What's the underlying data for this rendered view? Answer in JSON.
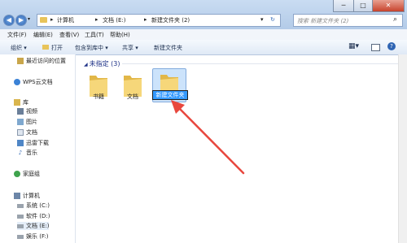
{
  "address": {
    "crumbs": [
      "计算机",
      "文档 (E:)",
      "新建文件夹 (2)"
    ],
    "search_placeholder": "搜索 新建文件夹 (2)"
  },
  "window_buttons": {
    "min": "─",
    "max": "□",
    "close": "✕"
  },
  "menu": [
    "文件(F)",
    "编辑(E)",
    "查看(V)",
    "工具(T)",
    "帮助(H)"
  ],
  "toolbar": {
    "organize": "组织 ▾",
    "open": "打开",
    "include": "包含到库中 ▾",
    "share": "共享 ▾",
    "new_folder": "新建文件夹"
  },
  "sidebar": {
    "recent": "最近访问的位置",
    "wps": "WPS云文档",
    "library": "库",
    "lib_items": [
      "视频",
      "图片",
      "文档",
      "迅雷下载",
      "音乐"
    ],
    "homegroup": "家庭组",
    "computer": "计算机",
    "drives": [
      "系统 (C:)",
      "软件 (D:)",
      "文档 (E:)",
      "娱乐 (F:)"
    ]
  },
  "content": {
    "group_header": "未指定 (3)",
    "folders": [
      "书籍",
      "文档"
    ],
    "rename_value": "新建文件夹"
  },
  "colors": {
    "arrow": "#e8473e",
    "accent": "#3399ff"
  }
}
